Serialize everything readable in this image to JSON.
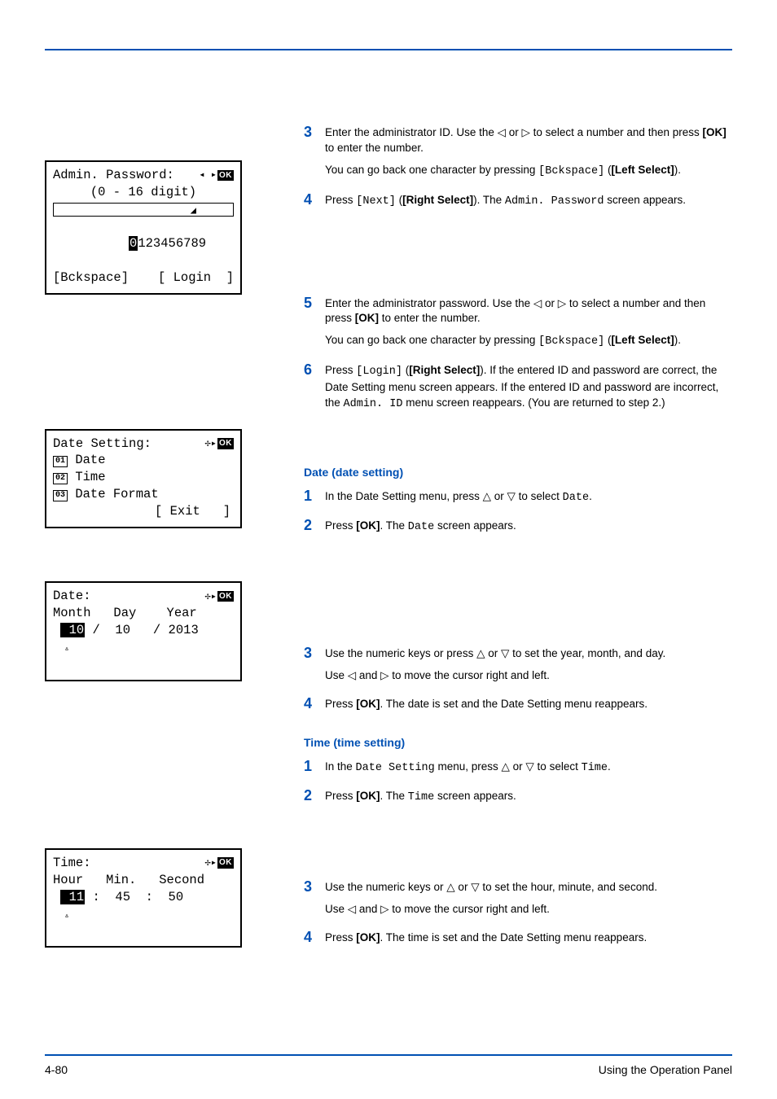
{
  "lcd_password": {
    "title": "Admin. Password:",
    "hint": "(0 - 16 digit)",
    "digits_hl": "0",
    "digits_rest": "123456789",
    "softleft": "[Bckspace]",
    "softright": "[ Login  ]"
  },
  "lcd_datesetting": {
    "title": "Date Setting:",
    "items": [
      {
        "num": "01",
        "label": " Date"
      },
      {
        "num": "02",
        "label": " Time"
      },
      {
        "num": "03",
        "label": " Date Format"
      }
    ],
    "exit": "[ Exit   ]"
  },
  "lcd_date": {
    "title": "Date:",
    "header": "Month   Day    Year",
    "month_hl": " 10",
    "rest": " /  10   / 2013"
  },
  "lcd_time": {
    "title": "Time:",
    "header": "Hour   Min.   Second",
    "hour_hl": " 11",
    "rest": " :  45  :  50"
  },
  "steps_a": {
    "s3a": "Enter the administrator ID. Use the ◁ or ▷ to select a number and then press ",
    "s3a_b1": "[OK]",
    "s3a2": " to enter the number.",
    "s3b": "You can go back one character by pressing ",
    "s3b_mono": "[Bckspace]",
    "s3b2": " (",
    "s3b_b": "[Left Select]",
    "s3b3": ").",
    "s4a": "Press ",
    "s4a_mono": "[Next]",
    "s4a2": " (",
    "s4a_b": "[Right Select]",
    "s4a3": "). The ",
    "s4a_mono2": "Admin. Password",
    "s4a4": " screen appears."
  },
  "steps_b": {
    "s5a": "Enter the administrator password. Use the ◁ or ▷ to select a number and then press ",
    "s5a_b": "[OK]",
    "s5a2": " to enter the number.",
    "s5b": "You can go back one character by pressing ",
    "s5b_mono": "[Bckspace]",
    "s5b2": " (",
    "s5b_b": "[Left Select]",
    "s5b3": ").",
    "s6a": "Press ",
    "s6a_mono": "[Login]",
    "s6a2": " (",
    "s6a_b": "[Right Select]",
    "s6a3": "). If the entered ID and password are correct, the Date Setting menu screen appears. If the entered ID and password are incorrect, the ",
    "s6a_mono2": "Admin. ID",
    "s6a4": " menu screen  reappears. (You are returned to step 2.)"
  },
  "date_section": {
    "title": "Date (date setting)",
    "s1": "In the Date Setting menu, press △ or ▽ to select ",
    "s1_mono": "Date",
    "s1b": ".",
    "s2": "Press ",
    "s2_b": "[OK]",
    "s2b": ". The ",
    "s2_mono": "Date",
    "s2c": " screen appears.",
    "s3": "Use the numeric keys or press △ or ▽ to set the year, month, and day.",
    "s3b": "Use ◁ and ▷ to move the cursor right and left.",
    "s4": "Press ",
    "s4_b": "[OK]",
    "s4b": ". The date is set and the Date Setting menu reappears."
  },
  "time_section": {
    "title": "Time (time setting)",
    "s1a": "In the ",
    "s1_mono": "Date Setting",
    "s1b": " menu, press △ or ▽ to select ",
    "s1_mono2": "Time",
    "s1c": ".",
    "s2": "Press ",
    "s2_b": "[OK]",
    "s2b": ". The ",
    "s2_mono": "Time",
    "s2c": " screen appears.",
    "s3": "Use the numeric keys or △ or ▽ to set the hour, minute, and second.",
    "s3b": "Use ◁ and ▷ to move the cursor right and left.",
    "s4": "Press ",
    "s4_b": "[OK]",
    "s4b": ". The time is set and the Date Setting menu reappears."
  },
  "footer": {
    "page": "4-80",
    "label": "Using the Operation Panel"
  }
}
